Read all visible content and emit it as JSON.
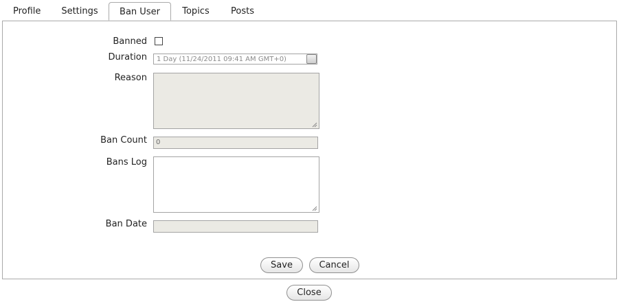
{
  "tabs": [
    {
      "label": "Profile",
      "active": false
    },
    {
      "label": "Settings",
      "active": false
    },
    {
      "label": "Ban User",
      "active": true
    },
    {
      "label": "Topics",
      "active": false
    },
    {
      "label": "Posts",
      "active": false
    }
  ],
  "form": {
    "banned": {
      "label": "Banned",
      "checked": false
    },
    "duration": {
      "label": "Duration",
      "value": "1 Day (11/24/2011 09:41 AM GMT+0)"
    },
    "reason": {
      "label": "Reason",
      "value": ""
    },
    "ban_count": {
      "label": "Ban Count",
      "value": "0"
    },
    "bans_log": {
      "label": "Bans Log",
      "value": ""
    },
    "ban_date": {
      "label": "Ban Date",
      "value": ""
    }
  },
  "actions": {
    "save_label": "Save",
    "cancel_label": "Cancel",
    "close_label": "Close"
  }
}
